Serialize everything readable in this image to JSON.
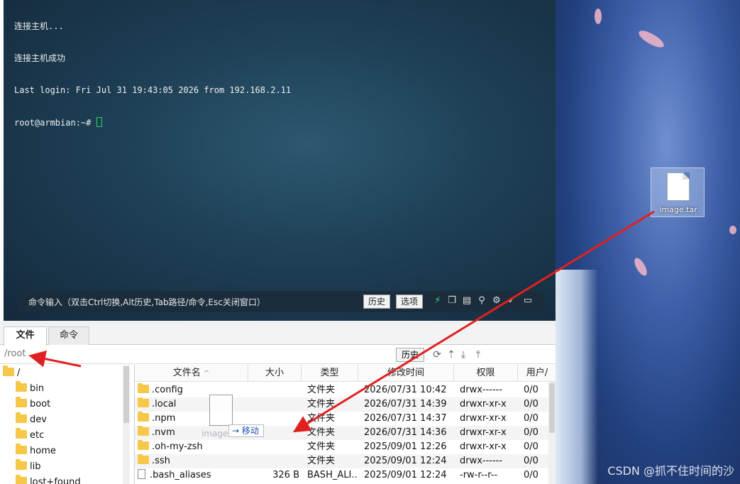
{
  "terminal": {
    "lines": [
      "连接主机...",
      "连接主机成功",
      "Last login: Fri Jul 31 19:43:05 2026 from 192.168.2.11",
      "root@armbian:~# "
    ],
    "command_hint": "命令输入（双击Ctrl切换,Alt历史,Tab路径/命令,Esc关闭窗口）",
    "history_button": "历史",
    "options_button": "选项",
    "toolbar_icons": [
      "lightning-icon",
      "copy-icon",
      "paste-icon",
      "search-icon",
      "gear-icon",
      "check-icon",
      "window-icon"
    ]
  },
  "tabs": [
    {
      "label": "文件"
    },
    {
      "label": "命令"
    }
  ],
  "path": {
    "value": "/root",
    "history_button": "历史"
  },
  "path_icons": [
    "refresh-icon",
    "up-icon",
    "download-icon",
    "upload-icon"
  ],
  "tree": {
    "root": "/",
    "items": [
      "bin",
      "boot",
      "dev",
      "etc",
      "home",
      "lib",
      "lost+found"
    ]
  },
  "file_list": {
    "columns": [
      "文件名",
      "大小",
      "类型",
      "修改时间",
      "权限",
      "用户/"
    ],
    "rows": [
      {
        "name": ".config",
        "size": "",
        "type": "文件夹",
        "modified": "2026/07/31 10:42",
        "perm": "drwx------",
        "owner": "0/0",
        "kind": "folder"
      },
      {
        "name": ".local",
        "size": "",
        "type": "文件夹",
        "modified": "2026/07/31 14:39",
        "perm": "drwxr-xr-x",
        "owner": "0/0",
        "kind": "folder"
      },
      {
        "name": ".npm",
        "size": "",
        "type": "文件夹",
        "modified": "2026/07/31 14:37",
        "perm": "drwxr-xr-x",
        "owner": "0/0",
        "kind": "folder"
      },
      {
        "name": ".nvm",
        "size": "",
        "type": "文件夹",
        "modified": "2026/07/31 14:36",
        "perm": "drwxr-xr-x",
        "owner": "0/0",
        "kind": "folder"
      },
      {
        "name": ".oh-my-zsh",
        "size": "",
        "type": "文件夹",
        "modified": "2025/09/01 12:26",
        "perm": "drwxr-xr-x",
        "owner": "0/0",
        "kind": "folder"
      },
      {
        "name": ".ssh",
        "size": "",
        "type": "文件夹",
        "modified": "2025/09/01 12:24",
        "perm": "drwx------",
        "owner": "0/0",
        "kind": "folder"
      },
      {
        "name": ".bash_aliases",
        "size": "326 B",
        "type": "BASH_ALI...",
        "modified": "2025/09/01 12:24",
        "perm": "-rw-r--r--",
        "owner": "0/0",
        "kind": "file"
      }
    ]
  },
  "drag": {
    "file_label": "image.tar",
    "tooltip": "移动"
  },
  "desktop": {
    "icon_label": "image.tar",
    "watermark": "CSDN @抓不住时间的沙"
  },
  "colors": {
    "annotation_arrow": "#e02020",
    "terminal_cursor": "#2bd45a",
    "link_blue": "#1a4fb0"
  }
}
